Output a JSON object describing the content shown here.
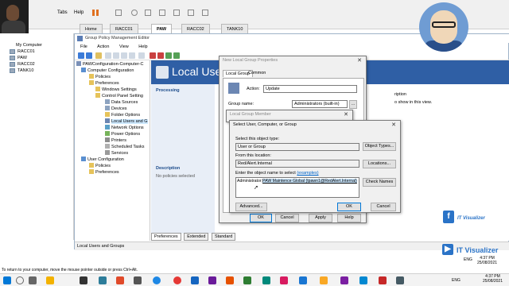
{
  "host": {
    "menu": [
      "Tabs",
      "Help"
    ],
    "vm_tabs": [
      "Home",
      "RACC01",
      "PAW",
      "RACC02",
      "TANK10"
    ],
    "active_tab": "PAW",
    "vm_list_header": "My Computer",
    "vm_list": [
      "RACC01",
      "PAW",
      "RACC02",
      "TANK10"
    ]
  },
  "gpme": {
    "title": "Group Policy Management Editor",
    "menu": [
      "File",
      "Action",
      "View",
      "Help"
    ],
    "tree": [
      {
        "label": "PAWConfiguration-Computer-C",
        "indent": 0
      },
      {
        "label": "Computer Configuration",
        "indent": 1
      },
      {
        "label": "Policies",
        "indent": 2
      },
      {
        "label": "Preferences",
        "indent": 2
      },
      {
        "label": "Windows Settings",
        "indent": 3
      },
      {
        "label": "Control Panel Setting",
        "indent": 3
      },
      {
        "label": "Data Sources",
        "indent": 4
      },
      {
        "label": "Devices",
        "indent": 4
      },
      {
        "label": "Folder Options",
        "indent": 4
      },
      {
        "label": "Local Users and G",
        "indent": 4,
        "selected": true
      },
      {
        "label": "Network Options",
        "indent": 4
      },
      {
        "label": "Power Options",
        "indent": 4
      },
      {
        "label": "Printers",
        "indent": 4
      },
      {
        "label": "Scheduled Tasks",
        "indent": 4
      },
      {
        "label": "Services",
        "indent": 4
      },
      {
        "label": "User Configuration",
        "indent": 1
      },
      {
        "label": "Policies",
        "indent": 2
      },
      {
        "label": "Preferences",
        "indent": 2
      }
    ],
    "banner_title": "Local Use",
    "processing_label": "Processing",
    "description_label": "Description",
    "no_policies": "No policies selected",
    "right_note_line1": "ription",
    "right_note_line2": "o show in this view.",
    "view_tabs": [
      "Preferences",
      "Extended",
      "Standard"
    ],
    "status": "Local Users and Groups"
  },
  "lgp_dialog": {
    "title": "New Local Group Properties",
    "tabs": [
      "Local Group",
      "Common"
    ],
    "action_label": "Action:",
    "action_value": "Update",
    "group_name_label": "Group name:",
    "group_name_value": "Administrators (built-in)",
    "ok": "OK",
    "cancel": "Cancel",
    "apply": "Apply",
    "help": "Help"
  },
  "lgm_dialog": {
    "title": "Local Group Member"
  },
  "select_dialog": {
    "title": "Select User, Computer, or Group",
    "object_type_label": "Select this object type:",
    "object_type_value": "User or Group",
    "object_types_btn": "Object Types...",
    "location_label": "From this location:",
    "location_value": "Red/Alert.Internal",
    "locations_btn": "Locations...",
    "enter_label": "Enter the object name to select",
    "examples_link": "(examples)",
    "entered_prefix": "Administrator;",
    "entered_selected": "PAW Maintence Global (tpawn1@RedAlert.Internal)",
    "check_names_btn": "Check Names",
    "advanced_btn": "Advanced...",
    "ok": "OK",
    "cancel": "Cancel"
  },
  "overlay": {
    "brand": "IT Visualizer",
    "brand2": "IT Visualizer"
  },
  "hint": "To return to your computer, move the mouse pointer outside or press Ctrl+Alt.",
  "clock": {
    "time": "4:37 PM",
    "date": "25/08/2021",
    "lang": "ENG"
  },
  "clock_bottom": {
    "time": "4:37 PM",
    "date": "25/08/2021",
    "lang": "ENG"
  },
  "colors": {
    "banner": "#2f5fa5",
    "selection": "#cce8ff",
    "accent": "#0078d7"
  }
}
